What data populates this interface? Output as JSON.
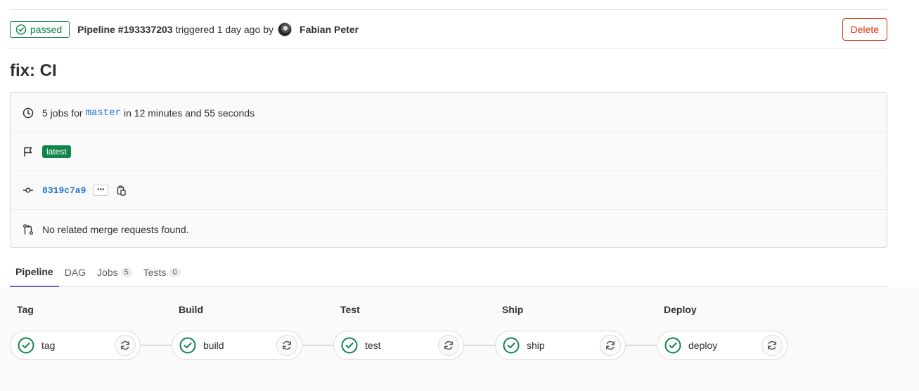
{
  "header": {
    "status": "passed",
    "pipeline_id": "Pipeline #193337203",
    "triggered": "triggered 1 day ago",
    "by": "by",
    "author": "Fabian Peter",
    "delete_label": "Delete"
  },
  "title": "fix: CI",
  "info": {
    "jobs_prefix": "5 jobs for",
    "branch": "master",
    "duration": "in 12 minutes and 55 seconds",
    "latest_badge": "latest",
    "commit_sha": "8319c7a9",
    "ellipsis": "•••",
    "merge_requests": "No related merge requests found."
  },
  "tabs": [
    {
      "label": "Pipeline",
      "count": null,
      "active": true
    },
    {
      "label": "DAG",
      "count": null,
      "active": false
    },
    {
      "label": "Jobs",
      "count": "5",
      "active": false
    },
    {
      "label": "Tests",
      "count": "0",
      "active": false
    }
  ],
  "stages": [
    {
      "name": "Tag",
      "job": "tag",
      "status": "passed"
    },
    {
      "name": "Build",
      "job": "build",
      "status": "passed"
    },
    {
      "name": "Test",
      "job": "test",
      "status": "passed"
    },
    {
      "name": "Ship",
      "job": "ship",
      "status": "passed"
    },
    {
      "name": "Deploy",
      "job": "deploy",
      "status": "passed"
    }
  ],
  "colors": {
    "success": "#108548",
    "danger": "#dd2b0e",
    "link": "#1f75cb",
    "tab_active": "#6666c4"
  },
  "icons": {
    "status": "check-circle-icon",
    "duration": "clock-icon",
    "latest": "flag-icon",
    "commit": "commit-icon",
    "copy": "clipboard-icon",
    "merge": "merge-request-icon",
    "retry": "retry-icon"
  }
}
